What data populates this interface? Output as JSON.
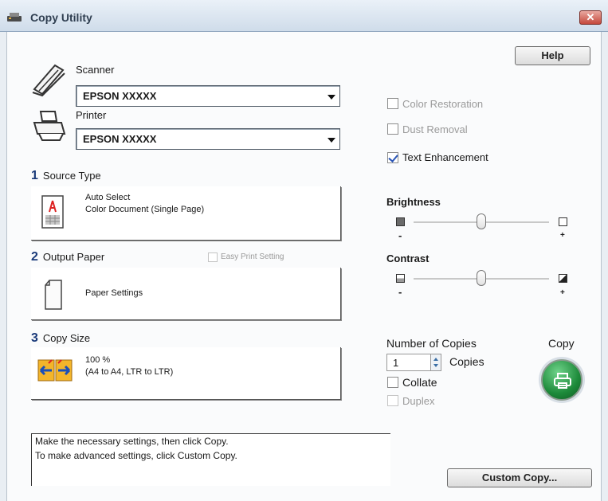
{
  "window": {
    "title": "Copy Utility",
    "close_label": "✕"
  },
  "help_label": "Help",
  "scanner": {
    "label": "Scanner",
    "value": "EPSON XXXXX"
  },
  "printer": {
    "label": "Printer",
    "value": "EPSON XXXXX"
  },
  "source_type": {
    "number": "1",
    "label": "Source Type",
    "line1": "Auto Select",
    "line2": "Color Document (Single Page)"
  },
  "output_paper": {
    "number": "2",
    "label": "Output Paper",
    "easy_print_label": "Easy Print Setting",
    "settings_label": "Paper Settings"
  },
  "copy_size": {
    "number": "3",
    "label": "Copy Size",
    "line1": "100 %",
    "line2": "(A4 to A4, LTR to LTR)"
  },
  "options": {
    "color_restoration": {
      "label": "Color Restoration",
      "checked": false
    },
    "dust_removal": {
      "label": "Dust Removal",
      "checked": false
    },
    "text_enhancement": {
      "label": "Text Enhancement",
      "checked": true
    }
  },
  "brightness": {
    "label": "Brightness",
    "minus": "-",
    "plus": "+",
    "level": 0.5
  },
  "contrast": {
    "label": "Contrast",
    "minus": "-",
    "plus": "+",
    "level": 0.5
  },
  "copies": {
    "label": "Number of Copies",
    "value": "1",
    "unit": "Copies",
    "collate_label": "Collate",
    "duplex_label": "Duplex"
  },
  "copy_button_label": "Copy",
  "status": {
    "line1": "Make the necessary settings, then click Copy.",
    "line2": "To make advanced settings, click Custom Copy."
  },
  "custom_copy_label": "Custom Copy..."
}
